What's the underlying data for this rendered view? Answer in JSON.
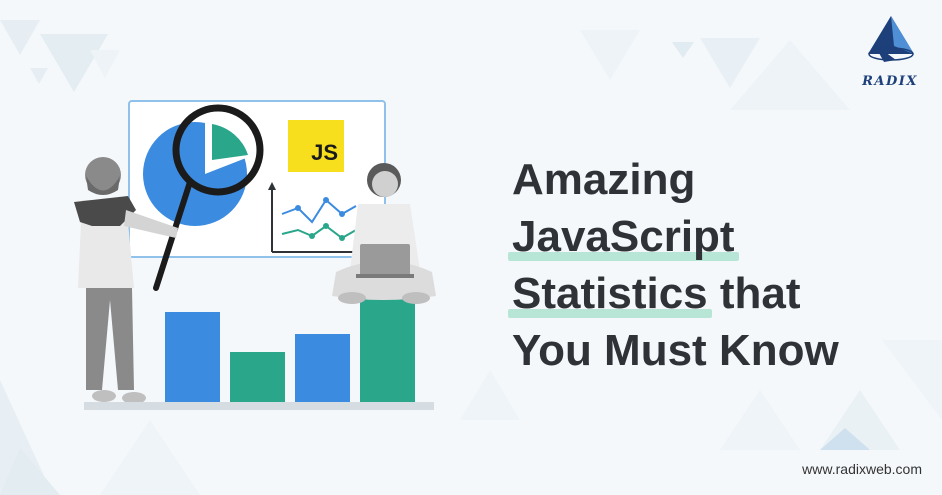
{
  "brand": {
    "logo_text": "RADIX",
    "logo_colors": {
      "dark": "#1d3f7a",
      "light": "#4f8fd6"
    }
  },
  "headline": {
    "lines": [
      "Amazing",
      "JavaScript",
      "Statistics that",
      "You Must Know"
    ],
    "highlight_words": [
      "JavaScript",
      "Statistics"
    ],
    "highlight_color": "#b7e6d6",
    "text_color": "#2f3337"
  },
  "website": "www.radixweb.com",
  "badge": {
    "label": "JS",
    "color": "#f7df1e"
  },
  "colors": {
    "background": "#f4f8fb",
    "blue": "#3b8be0",
    "teal": "#2aa68a",
    "board_border": "#8fc1ea"
  },
  "illustration": {
    "bars": [
      {
        "color": "blue",
        "level": 0.6
      },
      {
        "color": "teal",
        "level": 0.34
      },
      {
        "color": "blue",
        "level": 0.44
      },
      {
        "color": "teal",
        "level": 0.7
      }
    ],
    "icons": [
      "pie-chart-icon",
      "magnifier-icon",
      "line-chart-icon",
      "laptop-icon"
    ]
  }
}
